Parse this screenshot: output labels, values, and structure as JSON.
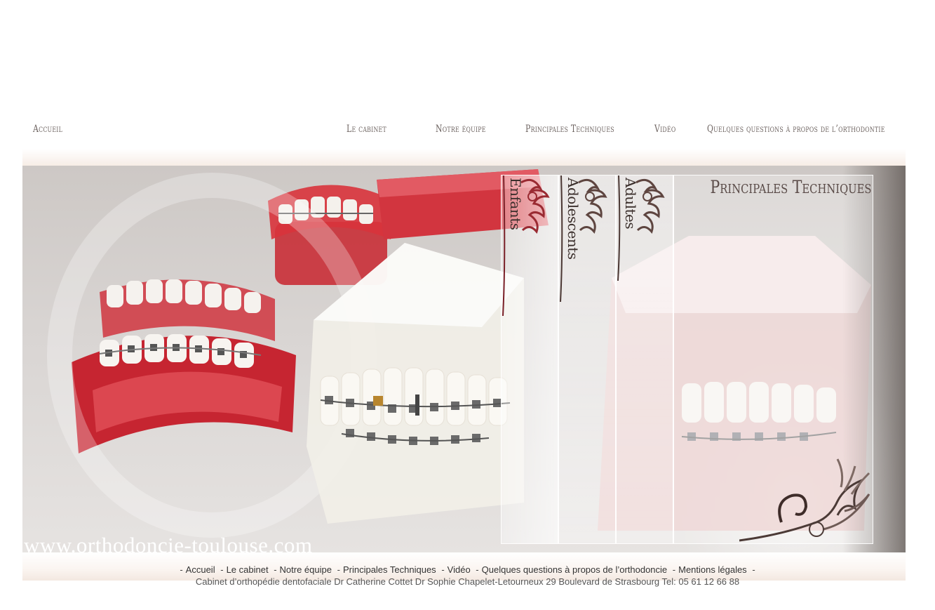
{
  "nav": {
    "accueil": "Accueil",
    "le_cabinet": "Le cabinet",
    "notre_equipe": "Notre équipe",
    "principales_techniques": "Principales Techniques",
    "video": "Vidéo",
    "questions": "Quelques questions à propos de l’orthodontie"
  },
  "hero": {
    "panel_title": "Principales Techniques",
    "tabs": [
      {
        "label": "Enfants"
      },
      {
        "label": "Adolescents"
      },
      {
        "label": "Adultes"
      }
    ],
    "site_url": "www.orthodoncie-toulouse.com"
  },
  "footer": {
    "links": [
      "Accueil",
      "Le cabinet",
      "Notre équipe",
      "Principales Techniques",
      "Vidéo",
      "Quelques questions à propos de l’orthodoncie",
      "Mentions légales"
    ],
    "address": "Cabinet d’orthopédie dentofaciale Dr Catherine Cottet Dr Sophie Chapelet-Letourneux 29 Boulevard de Strasbourg Tel: 05 61 12 66 88"
  },
  "colors": {
    "nav_text": "#6d6360",
    "gum_red": "#c8242e",
    "panel_text": "#3b2f2c"
  }
}
